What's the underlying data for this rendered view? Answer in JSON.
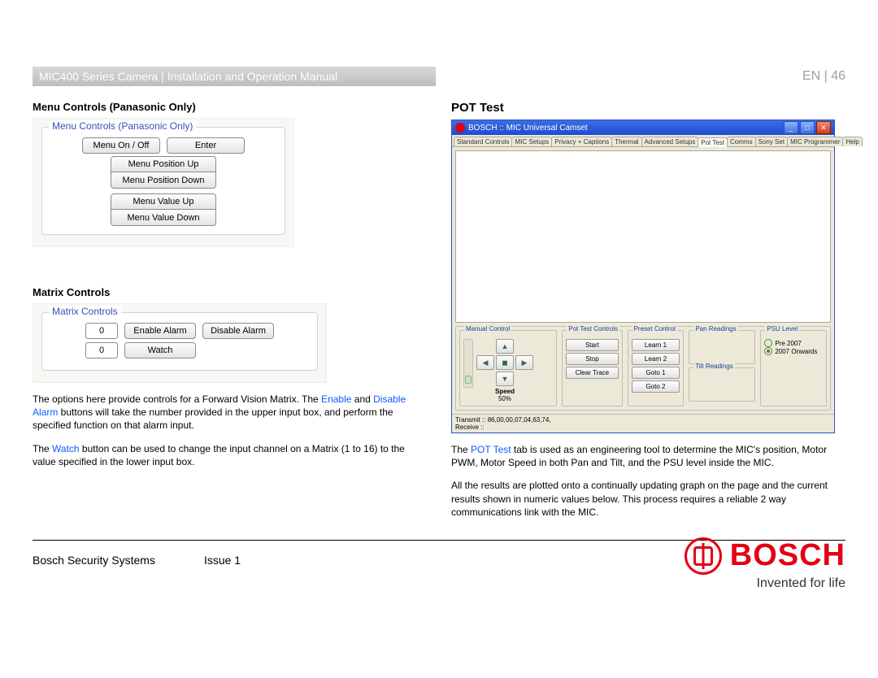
{
  "header": {
    "grey_title": "MIC400 Series Camera | Installation and Operation Manual",
    "lang": "EN",
    "pipe": " | ",
    "page": "46"
  },
  "left": {
    "menu_controls_title": "Menu Controls (Panasonic Only)",
    "menu_controls_grp": "Menu Controls (Panasonic Only)",
    "menu_onoff": "Menu On / Off",
    "enter": "Enter",
    "menu_pos_up": "Menu Position Up",
    "menu_pos_down": "Menu Position Down",
    "menu_val_up": "Menu Value Up",
    "menu_val_down": "Menu Value Down",
    "matrix_title": "Matrix Controls",
    "matrix_grp": "Matrix Controls",
    "num1": "0",
    "num2": "0",
    "enable": "Enable Alarm",
    "disable": "Disable Alarm",
    "watch": "Watch",
    "para1_a": "The options here provide controls for a Forward Vision Matrix. The ",
    "para1_enable": "Enable",
    "para1_b": " and ",
    "para1_disable": "Disable Alarm",
    "para1_c": " buttons will take the number provided in the upper input box, and perform the specified function on that alarm input.",
    "para2_a": "The ",
    "para2_watch": "Watch",
    "para2_b": " button can be used to change the input channel on a Matrix (1 to 16) to the value specified in the lower input box."
  },
  "right": {
    "title": "POT Test",
    "app_title": "BOSCH :: MIC Universal Camset",
    "tabs": [
      "Standard Controls",
      "MIC Setups",
      "Privacy + Captions",
      "Thermal",
      "Advanced Setups",
      "Pot Test",
      "Comms",
      "Sony Set",
      "MIC Programmer",
      "Help"
    ],
    "active_tab": 5,
    "manual": "Manual Control",
    "speed_label": "Speed",
    "speed_val": "50%",
    "pottest": "Pot Test Controls",
    "pot_start": "Start",
    "pot_stop": "Stop",
    "pot_clear": "Clear Trace",
    "preset": "Preset Control",
    "preset_learn1": "Learn 1",
    "preset_learn2": "Learn 2",
    "preset_goto1": "Goto 1",
    "preset_goto2": "Goto 2",
    "pan": "Pan Readings",
    "tilt": "Tilt Readings",
    "psu": "PSU Level",
    "psu_pre": "Pre 2007",
    "psu_on": "2007 Onwards",
    "transmit": "Transmit :: 86,00,00,07,04,63,74,",
    "receive": "Receive ::",
    "para1_a": "The ",
    "para1_link": "POT Test",
    "para1_b": " tab is used as an engineering tool to determine the MIC's position, Motor PWM, Motor Speed in both Pan and Tilt, and the PSU level inside the MIC.",
    "para2": "All the results are plotted onto a continually updating graph on the page and the current results shown in numeric values below. This process requires a reliable 2 way communications link with the MIC."
  },
  "footer": {
    "company": "Bosch Security Systems",
    "issue": "Issue 1",
    "brand": "BOSCH",
    "slogan": "Invented for life"
  }
}
